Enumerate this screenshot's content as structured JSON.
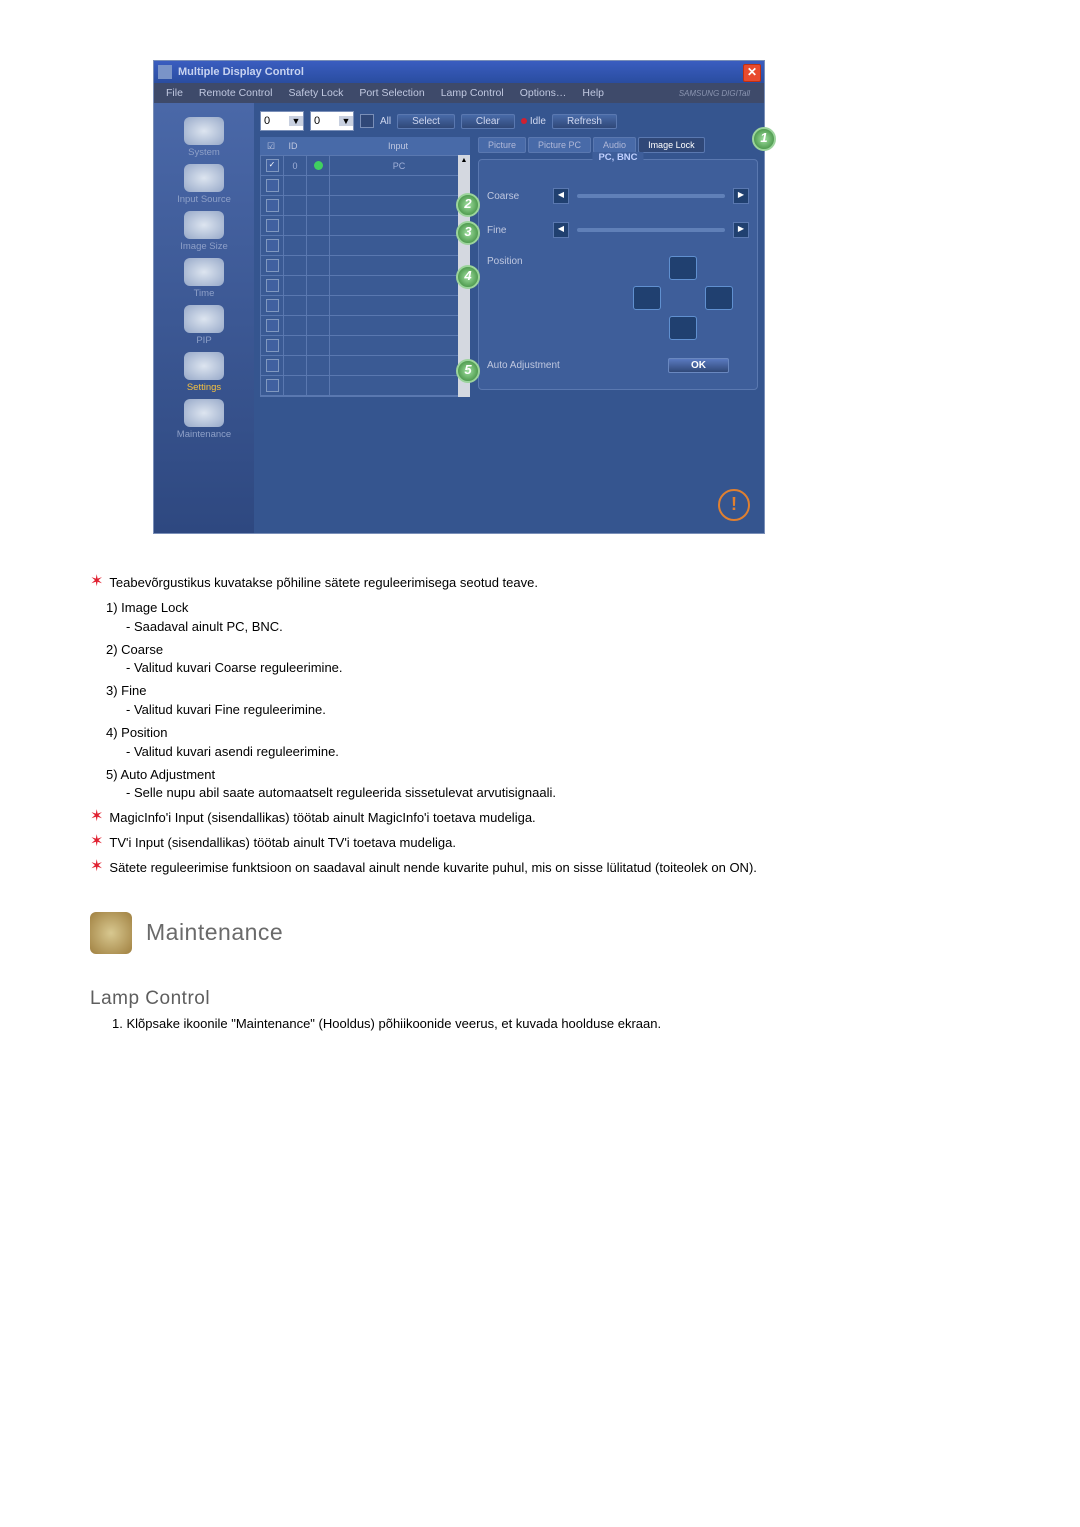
{
  "window": {
    "title": "Multiple Display Control",
    "brand": "SAMSUNG DIGITall"
  },
  "menu": [
    "File",
    "Remote Control",
    "Safety Lock",
    "Port Selection",
    "Lamp Control",
    "Options…",
    "Help"
  ],
  "sidebar": [
    {
      "label": "System"
    },
    {
      "label": "Input Source"
    },
    {
      "label": "Image Size"
    },
    {
      "label": "Time"
    },
    {
      "label": "PIP"
    },
    {
      "label": "Settings"
    },
    {
      "label": "Maintenance"
    }
  ],
  "toolbar": {
    "dd1": "0",
    "dd2": "0",
    "all": "All",
    "select": "Select",
    "clear": "Clear",
    "idle": "Idle",
    "refresh": "Refresh"
  },
  "grid": {
    "headers": {
      "c1": "☑",
      "c2": "ID",
      "c3": "",
      "c4": "Input"
    },
    "rows": [
      {
        "checked": true,
        "id": "0",
        "status": "O",
        "input": "PC"
      },
      {
        "checked": false
      },
      {
        "checked": false
      },
      {
        "checked": false
      },
      {
        "checked": false
      },
      {
        "checked": false
      },
      {
        "checked": false
      },
      {
        "checked": false
      },
      {
        "checked": false
      },
      {
        "checked": false
      },
      {
        "checked": false
      },
      {
        "checked": false
      }
    ]
  },
  "subtabs": [
    "Picture",
    "Picture PC",
    "Audio",
    "Image Lock"
  ],
  "panel": {
    "group_title": "PC, BNC",
    "coarse": "Coarse",
    "fine": "Fine",
    "position": "Position",
    "auto": "Auto Adjustment",
    "ok": "OK"
  },
  "callouts": {
    "c1": "1",
    "c2": "2",
    "c3": "3",
    "c4": "4",
    "c5": "5"
  },
  "desc": {
    "star1": "Teabevõrgustikus kuvatakse põhiline sätete reguleerimisega seotud teave.",
    "i1_t": "1) Image Lock",
    "i1_s": "- Saadaval ainult PC, BNC.",
    "i2_t": "2) Coarse",
    "i2_s": "- Valitud kuvari Coarse reguleerimine.",
    "i3_t": "3) Fine",
    "i3_s": "- Valitud kuvari Fine reguleerimine.",
    "i4_t": "4) Position",
    "i4_s": "- Valitud kuvari asendi reguleerimine.",
    "i5_t": "5) Auto Adjustment",
    "i5_s": "- Selle nupu abil saate automaatselt reguleerida sissetulevat arvutisignaali.",
    "star2": "MagicInfo'i Input (sisendallikas) töötab ainult MagicInfo'i toetava mudeliga.",
    "star3": "TV'i Input (sisendallikas) töötab ainult TV'i toetava mudeliga.",
    "star4": "Sätete reguleerimise funktsioon on saadaval ainult nende kuvarite puhul, mis on sisse lülitatud (toiteolek on ON)."
  },
  "section": {
    "maintenance": "Maintenance",
    "lamp": "Lamp Control",
    "lamp_1": "1.  Klõpsake ikoonile \"Maintenance\" (Hooldus) põhiikoonide veerus, et kuvada hoolduse ekraan."
  }
}
